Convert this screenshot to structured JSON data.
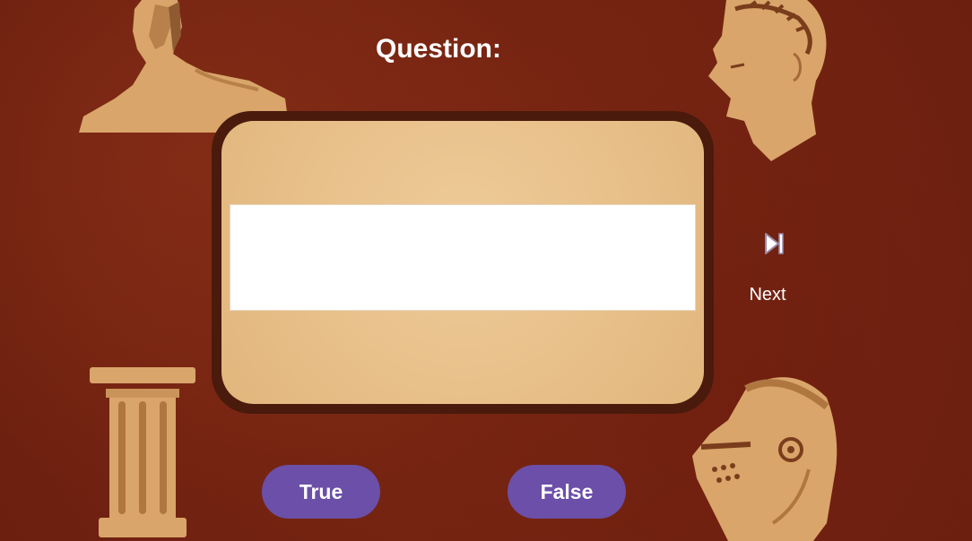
{
  "header": {
    "title": "Question:"
  },
  "question": {
    "text": ""
  },
  "navigation": {
    "next_label": "Next",
    "next_icon": "skip-next-icon"
  },
  "answers": {
    "true_label": "True",
    "false_label": "False"
  },
  "decorations": [
    "sphinx-illustration",
    "caesar-bust-illustration",
    "greek-column-illustration",
    "knight-helmet-illustration"
  ],
  "colors": {
    "background": "#7a2412",
    "card": "#e8bf88",
    "card_border": "#4a1a0c",
    "button": "#6b4fa8",
    "illustration": "#d9a56a"
  }
}
